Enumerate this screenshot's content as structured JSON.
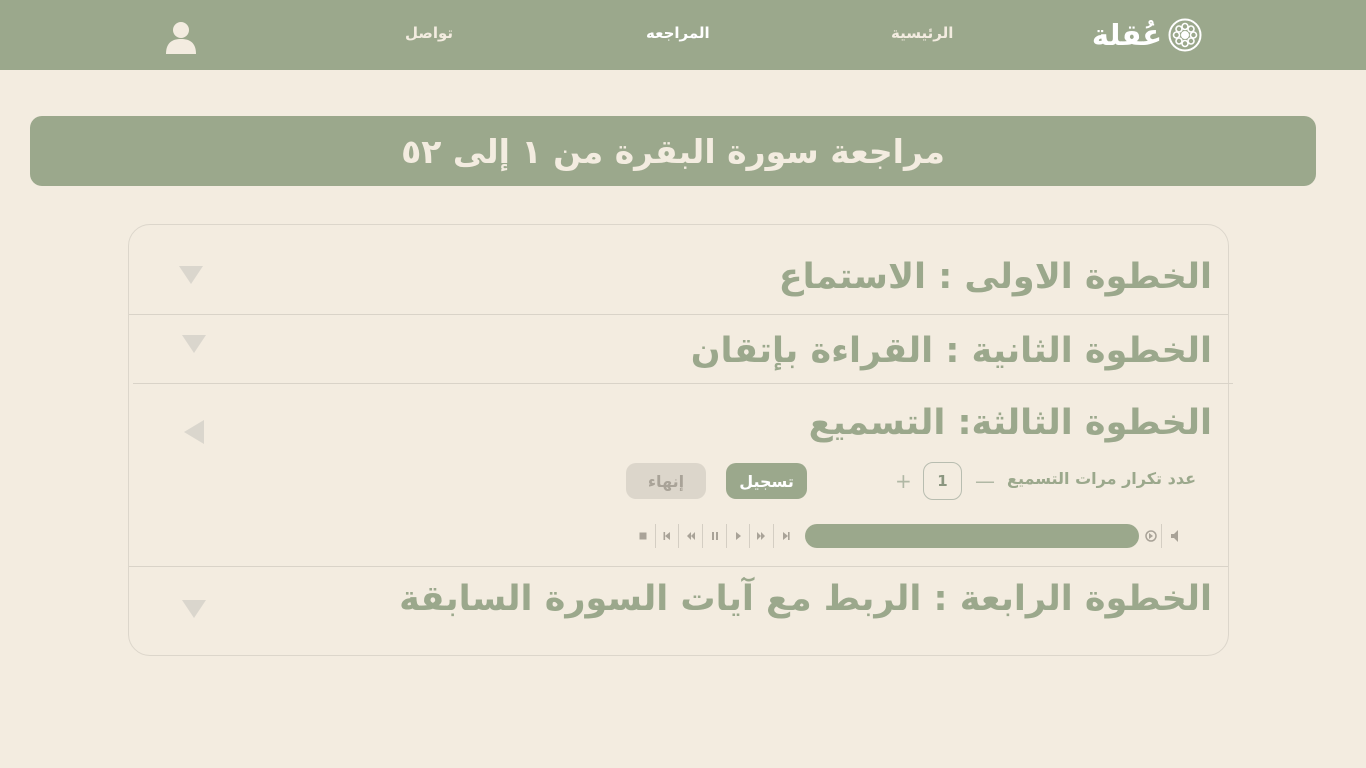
{
  "nav": {
    "logo_text": "عُقلة",
    "home": "الرئيسية",
    "review": "المراجعه",
    "contact": "تواصل"
  },
  "page_title": "مراجعة سورة البقرة من ١ إلى ٥٢",
  "steps": [
    {
      "title": "الخطوة الاولى : الاستماع",
      "expanded": false
    },
    {
      "title": "الخطوة الثانية : القراءة بإتقان",
      "expanded": false
    },
    {
      "title": "الخطوة الثالثة: التسميع",
      "expanded": true
    },
    {
      "title": "الخطوة الرابعة : الربط  مع آيات السورة السابقة",
      "expanded": false
    }
  ],
  "recitation": {
    "repeat_label": "عدد تكرار مرات التسميع",
    "repeat_value": "1",
    "minus": "—",
    "plus": "+",
    "record_label": "تسجيل",
    "finish_label": "إنهاء"
  },
  "audio_controls": [
    "mute-icon",
    "replay-icon",
    "skip-end-icon",
    "fast-forward-icon",
    "play-icon",
    "pause-icon",
    "rewind-icon",
    "skip-start-icon",
    "stop-icon"
  ],
  "colors": {
    "primary": "#9ba88c",
    "background": "#f3ece0",
    "muted": "#dcd6cb"
  }
}
